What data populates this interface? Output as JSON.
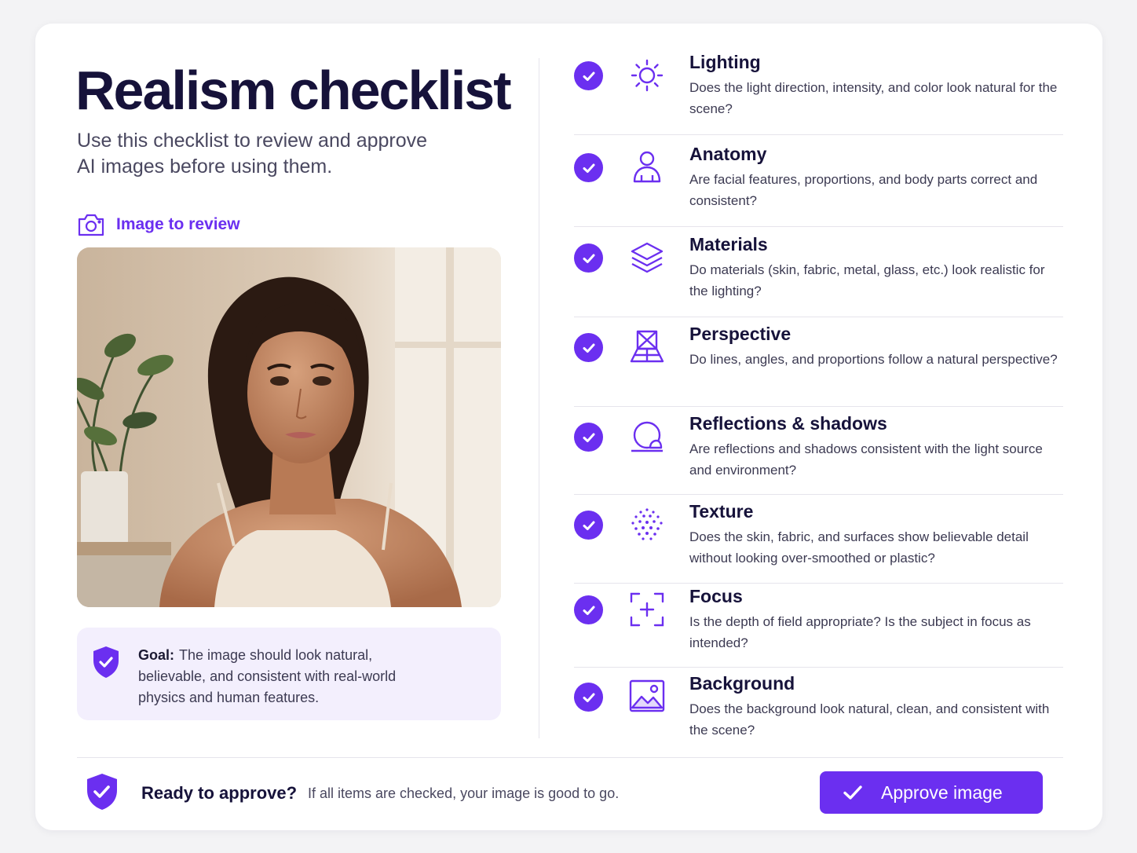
{
  "header": {
    "title": "Realism checklist",
    "subtitle": "Use this checklist to review and approve AI images before using them."
  },
  "review": {
    "label": "Image to review",
    "icon": "camera-icon"
  },
  "goal": {
    "label": "Goal:",
    "text": "The image should look natural, believable, and consistent with real-world physics and human features."
  },
  "checklist": [
    {
      "title": "Lighting",
      "description": "Does the light direction, intensity, and color look natural for the scene?",
      "icon": "sun-icon",
      "checked": true
    },
    {
      "title": "Anatomy",
      "description": "Are facial features, proportions, and body parts correct and consistent?",
      "icon": "person-icon",
      "checked": true
    },
    {
      "title": "Materials",
      "description": "Do materials (skin, fabric, metal, glass, etc.) look realistic for the lighting?",
      "icon": "layers-icon",
      "checked": true
    },
    {
      "title": "Perspective",
      "description": "Do lines, angles, and proportions follow a natural perspective?",
      "icon": "perspective-icon",
      "checked": true
    },
    {
      "title": "Reflections & shadows",
      "description": "Are reflections and shadows consistent with the light source and environment?",
      "icon": "sphere-shadow-icon",
      "checked": true
    },
    {
      "title": "Texture",
      "description": "Does the skin, fabric, and surfaces show believable detail without looking over-smoothed or plastic?",
      "icon": "dots-texture-icon",
      "checked": true
    },
    {
      "title": "Focus",
      "description": "Is the depth of field appropriate? Is the subject in focus as intended?",
      "icon": "focus-icon",
      "checked": true
    },
    {
      "title": "Background",
      "description": "Does the background look natural, clean, and consistent with the scene?",
      "icon": "image-icon",
      "checked": true
    }
  ],
  "footer": {
    "title": "Ready to approve?",
    "subtitle": "If all items are checked, your image is good to go.",
    "button_label": "Approve image"
  },
  "colors": {
    "accent": "#6b2ff0",
    "title": "#16123a",
    "goal_bg": "#f3effd"
  }
}
